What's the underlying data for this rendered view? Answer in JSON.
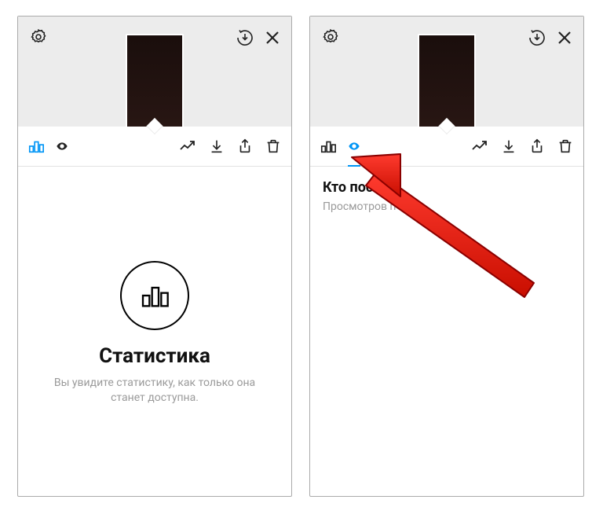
{
  "left_pane": {
    "stats_title": "Статистика",
    "stats_desc": "Вы увидите статистику, как только она станет доступна."
  },
  "right_pane": {
    "viewers_title": "Кто посмо",
    "viewers_sub": "Просмотров п"
  },
  "icons": {
    "settings": "settings-icon",
    "archive_download": "archive-download-icon",
    "close": "close-icon",
    "stats": "bar-chart-icon",
    "eye": "eye-icon",
    "trend": "trend-up-icon",
    "download": "download-icon",
    "share": "share-icon",
    "trash": "trash-icon"
  }
}
